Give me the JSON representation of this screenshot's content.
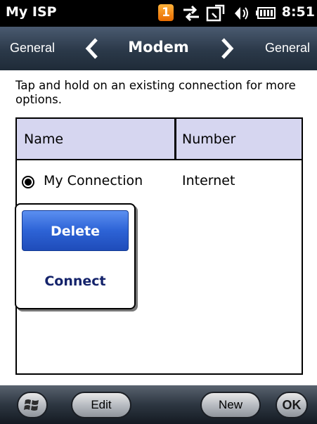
{
  "status_bar": {
    "app_title": "My ISP",
    "notification_count": "1",
    "time": "8:51",
    "icons": [
      "notification-badge-icon",
      "connectivity-arrows-icon",
      "sync-icon",
      "volume-icon",
      "battery-icon"
    ]
  },
  "header": {
    "left_label": "General",
    "title": "Modem",
    "right_label": "General"
  },
  "instruction": "Tap and hold on an existing connection for more options.",
  "table": {
    "columns": [
      "Name",
      "Number"
    ],
    "rows": [
      {
        "name": "My Connection",
        "number": "Internet",
        "selected": true
      }
    ]
  },
  "context_menu": {
    "items": [
      "Delete",
      "Connect"
    ],
    "highlighted": "Delete"
  },
  "bottom_bar": {
    "edit_label": "Edit",
    "new_label": "New",
    "ok_label": "OK"
  },
  "colors": {
    "header_bg": "#2b3949",
    "table_header_bg": "#d6d6f0",
    "menu_highlight": "#2d63d6",
    "connect_text": "#14236b",
    "notification_badge": "#f08a14"
  }
}
